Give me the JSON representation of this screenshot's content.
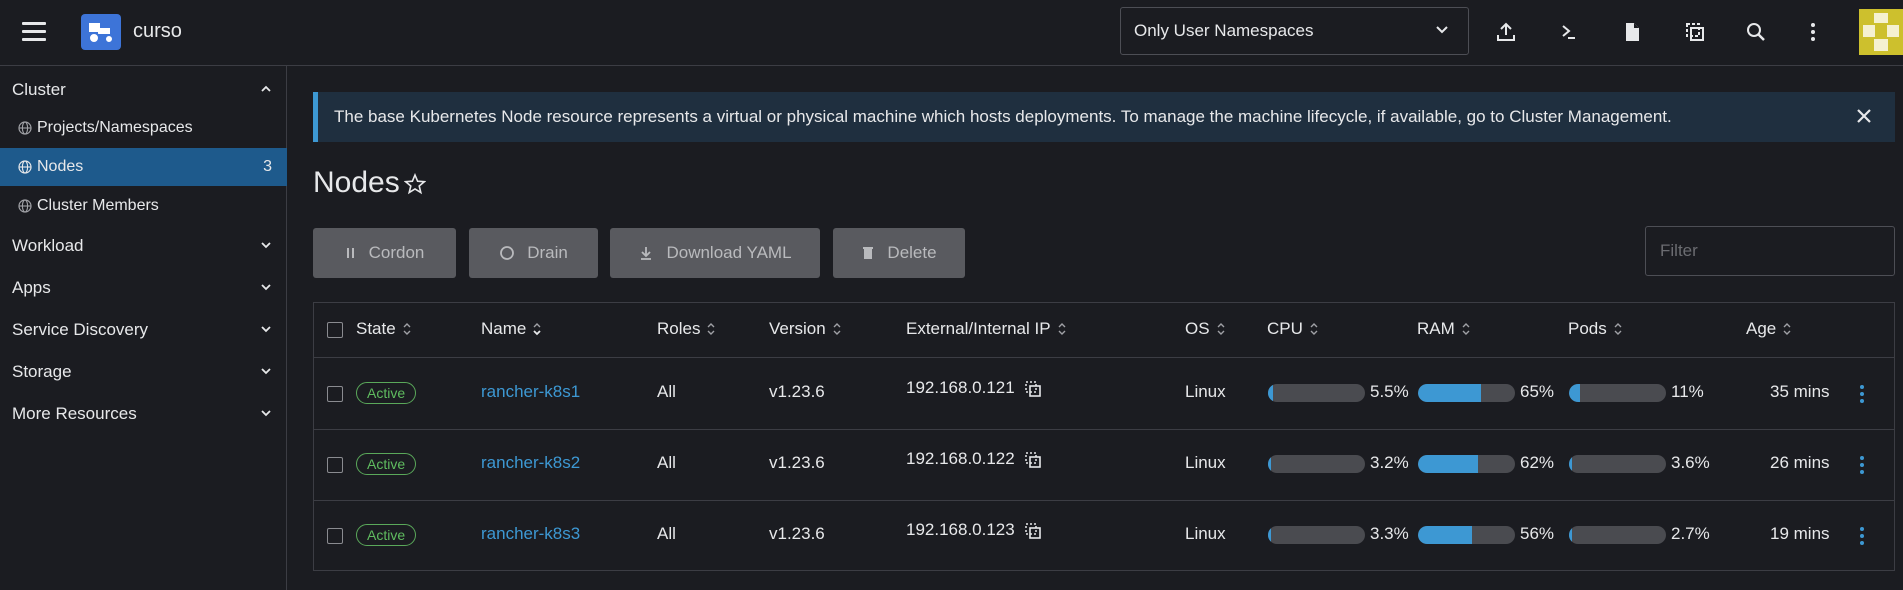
{
  "header": {
    "cluster_name": "curso",
    "namespace_filter": "Only User Namespaces"
  },
  "sidebar": {
    "cluster_label": "Cluster",
    "items": [
      {
        "label": "Projects/Namespaces",
        "count": ""
      },
      {
        "label": "Nodes",
        "count": "3"
      },
      {
        "label": "Cluster Members",
        "count": ""
      }
    ],
    "groups": [
      "Workload",
      "Apps",
      "Service Discovery",
      "Storage",
      "More Resources"
    ]
  },
  "banner": {
    "text": "The base Kubernetes Node resource represents a virtual or physical machine which hosts deployments. To manage the machine lifecycle, if available, go to Cluster Management."
  },
  "page": {
    "title": "Nodes"
  },
  "actions": {
    "cordon": "Cordon",
    "drain": "Drain",
    "download_yaml": "Download YAML",
    "delete": "Delete",
    "filter_placeholder": "Filter"
  },
  "table": {
    "headers": [
      "State",
      "Name",
      "Roles",
      "Version",
      "External/Internal IP",
      "OS",
      "CPU",
      "RAM",
      "Pods",
      "Age"
    ],
    "rows": [
      {
        "state": "Active",
        "name": "rancher-k8s1",
        "roles": "All",
        "version": "v1.23.6",
        "ip": "192.168.0.121",
        "os": "Linux",
        "cpu": "5.5%",
        "cpu_frac": 0.055,
        "ram": "65%",
        "ram_frac": 0.65,
        "pods": "11%",
        "pods_frac": 0.11,
        "age": "35 mins"
      },
      {
        "state": "Active",
        "name": "rancher-k8s2",
        "roles": "All",
        "version": "v1.23.6",
        "ip": "192.168.0.122",
        "os": "Linux",
        "cpu": "3.2%",
        "cpu_frac": 0.032,
        "ram": "62%",
        "ram_frac": 0.62,
        "pods": "3.6%",
        "pods_frac": 0.036,
        "age": "26 mins"
      },
      {
        "state": "Active",
        "name": "rancher-k8s3",
        "roles": "All",
        "version": "v1.23.6",
        "ip": "192.168.0.123",
        "os": "Linux",
        "cpu": "3.3%",
        "cpu_frac": 0.033,
        "ram": "56%",
        "ram_frac": 0.56,
        "pods": "2.7%",
        "pods_frac": 0.027,
        "age": "19 mins"
      }
    ]
  },
  "colors": {
    "accent": "#3d98d3",
    "active_nav": "#1e5a8c",
    "status_active": "#5fbb5f",
    "avatar": "#cdc02d"
  }
}
